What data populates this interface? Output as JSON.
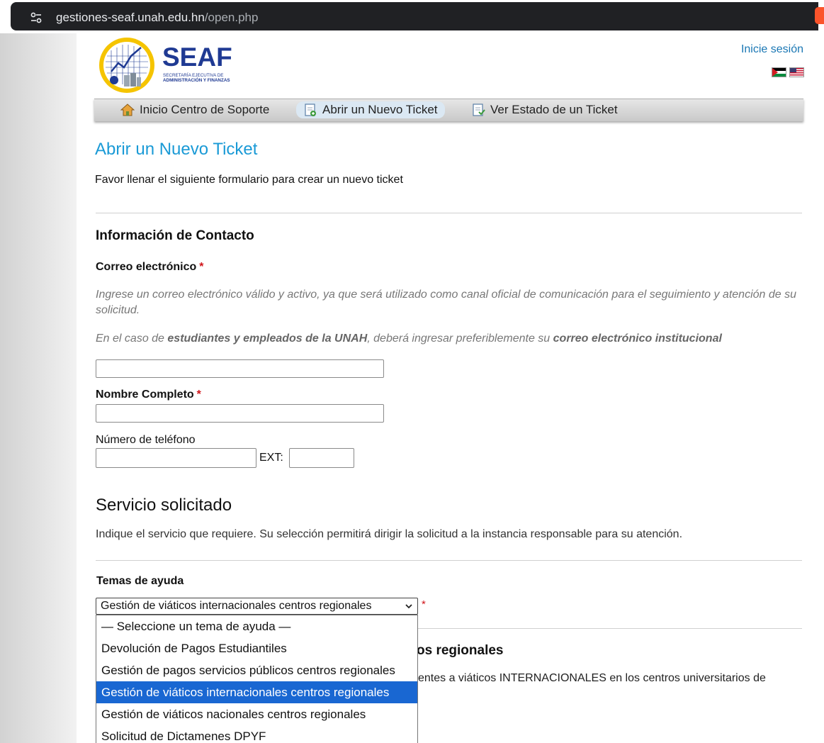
{
  "browser": {
    "url_host": "gestiones-seaf.unah.edu.hn",
    "url_path": "/open.php",
    "site_info_icon": "tune-icon",
    "brave_icon": "brave-lion-icon"
  },
  "header": {
    "logo_text": "SEAF",
    "logo_subtitle_1": "SECRETARÍA EJECUTIVA DE",
    "logo_subtitle_2": "ADMINISTRACIÓN Y FINANZAS",
    "signin_label": "Inicie sesión"
  },
  "nav": {
    "items": [
      {
        "label": "Inicio Centro de Soporte",
        "icon": "home-icon"
      },
      {
        "label": "Abrir un Nuevo Ticket",
        "icon": "new-ticket-icon"
      },
      {
        "label": "Ver Estado de un Ticket",
        "icon": "ticket-status-icon"
      }
    ]
  },
  "page": {
    "title": "Abrir un Nuevo Ticket",
    "intro": "Favor llenar el siguiente formulario para crear un nuevo ticket"
  },
  "contact": {
    "heading": "Información de Contacto",
    "email_label": "Correo electrónico",
    "required_mark": "*",
    "email_hint_1": "Ingrese un correo electrónico válido y activo, ya que será utilizado como canal oficial de comunicación para el seguimiento y atención de su solicitud.",
    "email_hint_2_a": "En el caso de ",
    "email_hint_2_b": "estudiantes y empleados de la UNAH",
    "email_hint_2_c": ", deberá ingresar preferiblemente su ",
    "email_hint_2_d": "correo electrónico institucional",
    "email_value": "",
    "name_label": "Nombre Completo",
    "name_value": "",
    "phone_label": "Número de teléfono",
    "phone_value": "",
    "ext_label": "EXT:",
    "ext_value": ""
  },
  "service": {
    "heading": "Servicio solicitado",
    "description": "Indique el servicio que requiere. Su selección permitirá dirigir la solicitud a la instancia responsable para su atención.",
    "topics_label": "Temas de ayuda",
    "selected": "Gestión de viáticos internacionales centros regionales",
    "options": [
      "— Seleccione un tema de ayuda —",
      "Devolución de Pagos Estudiantiles",
      "Gestión de pagos servicios públicos centros regionales",
      "Gestión de viáticos internacionales centros regionales",
      "Gestión de viáticos nacionales centros regionales",
      "Solicitud de Dictamenes DPYF"
    ],
    "selected_index": 3,
    "background_heading_fragment": "os regionales",
    "background_desc_fragment": "entes a viáticos INTERNACIONALES en los centros universitarios de"
  },
  "colors": {
    "link": "#1a77b4",
    "title": "#1a9ad6",
    "required": "#d0151a",
    "selected_option": "#1967d2"
  }
}
